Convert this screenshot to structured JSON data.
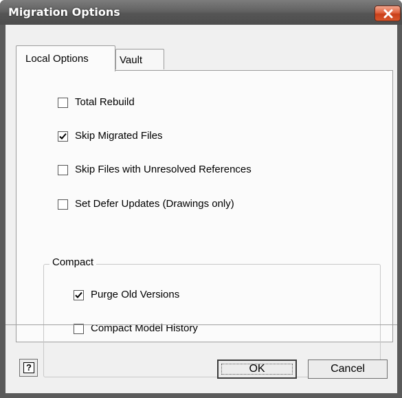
{
  "window": {
    "title": "Migration Options"
  },
  "tabs": [
    {
      "label": "Local Options",
      "selected": true
    },
    {
      "label": "Vault",
      "selected": false
    }
  ],
  "options": [
    {
      "label": "Total Rebuild",
      "checked": false
    },
    {
      "label": "Skip Migrated Files",
      "checked": true
    },
    {
      "label": "Skip Files with Unresolved References",
      "checked": false
    },
    {
      "label": "Set Defer Updates (Drawings only)",
      "checked": false
    }
  ],
  "compact": {
    "title": "Compact",
    "options": [
      {
        "label": "Purge Old Versions",
        "checked": true
      },
      {
        "label": "Compact Model History",
        "checked": false
      }
    ]
  },
  "footer": {
    "help_symbol": "?",
    "ok_label": "OK",
    "cancel_label": "Cancel"
  },
  "colors": {
    "titlebar": "#5a5a5a",
    "close_button": "#d8552b",
    "dialog_bg": "#f0f0f0"
  }
}
